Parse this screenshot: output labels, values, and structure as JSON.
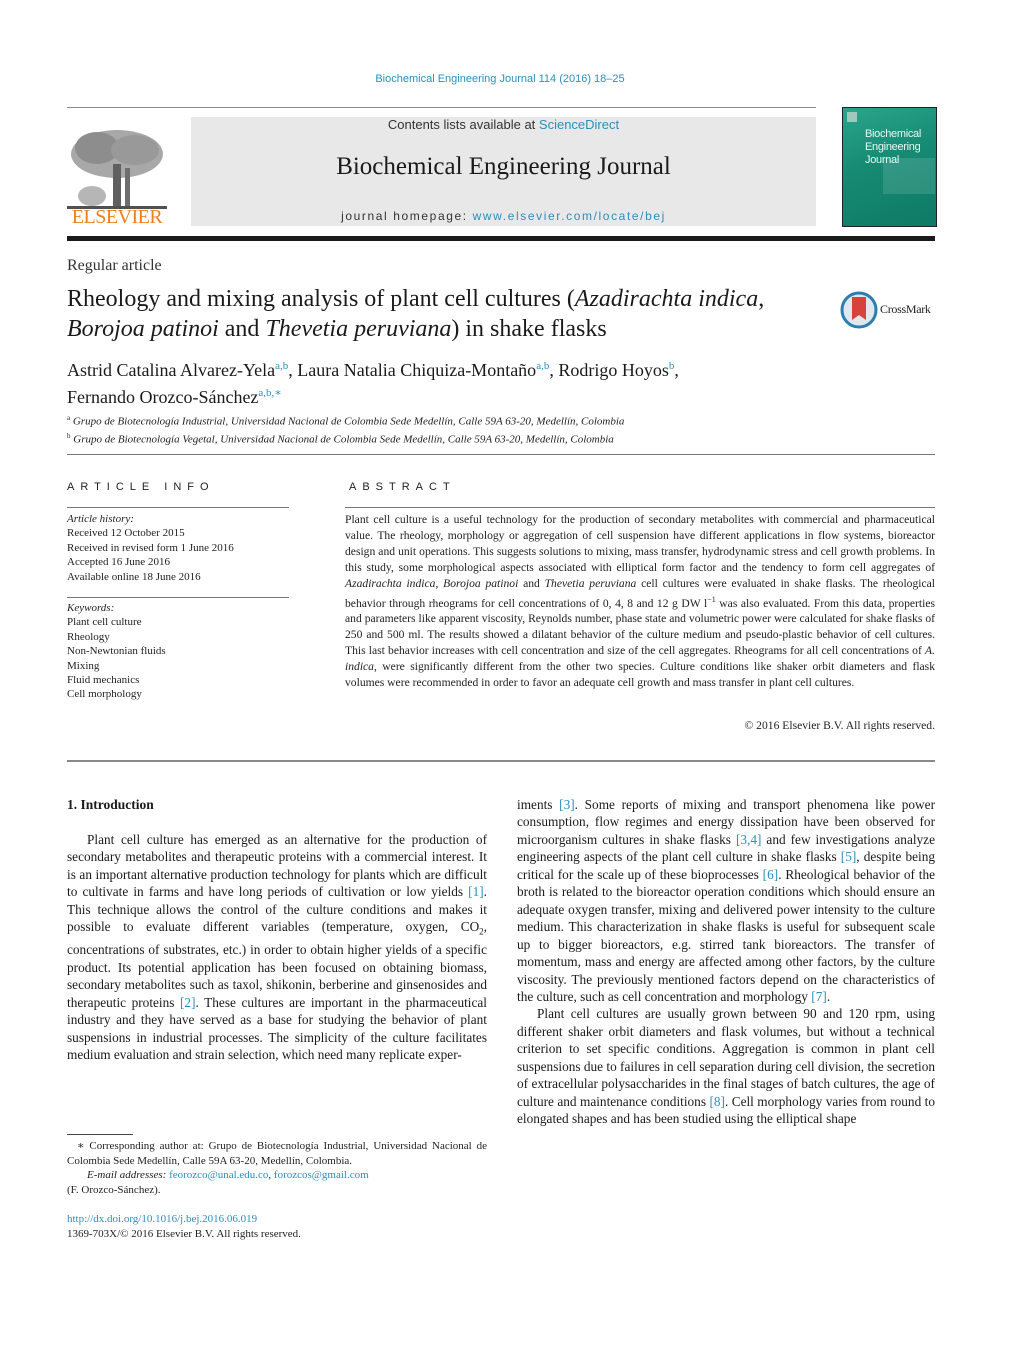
{
  "header": {
    "citation": "Biochemical Engineering Journal 114 (2016) 18–25",
    "contents_prefix": "Contents lists available at ",
    "contents_link": "ScienceDirect",
    "journal_name": "Biochemical Engineering Journal",
    "homepage_prefix": "journal homepage: ",
    "homepage_link": "www.elsevier.com/locate/bej",
    "publisher_wordmark": "ELSEVIER",
    "cover_title_lines": [
      "Biochemical",
      "Engineering",
      "Journal"
    ],
    "colors": {
      "link": "#2a8fbd",
      "elsevier_orange": "#f07f1a",
      "cover_green": "#168a73",
      "panel_gray": "#e8e8e8"
    }
  },
  "article": {
    "type": "Regular article",
    "title_parts": [
      {
        "text": "Rheology and mixing analysis of plant cell cultures (",
        "italic": false
      },
      {
        "text": "Azadirachta indica",
        "italic": true
      },
      {
        "text": ", ",
        "italic": false
      },
      {
        "text": "Borojoa patinoi",
        "italic": true
      },
      {
        "text": " and ",
        "italic": false
      },
      {
        "text": "Thevetia peruviana",
        "italic": true
      },
      {
        "text": ") in shake flasks",
        "italic": false
      }
    ],
    "crossmark_label": "CrossMark",
    "authors": [
      {
        "name": "Astrid Catalina Alvarez-Yela",
        "affil": "a,b"
      },
      {
        "name": "Laura Natalia Chiquiza-Montaño",
        "affil": "a,b"
      },
      {
        "name": "Rodrigo Hoyos",
        "affil": "b"
      },
      {
        "name": "Fernando Orozco-Sánchez",
        "affil": "a,b,∗"
      }
    ],
    "affiliations": [
      {
        "mark": "a",
        "text": "Grupo de Biotecnología Industrial, Universidad Nacional de Colombia Sede Medellín, Calle 59A 63-20, Medellín, Colombia"
      },
      {
        "mark": "b",
        "text": "Grupo de Biotecnología Vegetal, Universidad Nacional de Colombia Sede Medellín, Calle 59A 63-20, Medellín, Colombia"
      }
    ]
  },
  "article_info": {
    "heading": "ARTICLE INFO",
    "history_label": "Article history:",
    "history": [
      "Received 12 October 2015",
      "Received in revised form 1 June 2016",
      "Accepted 16 June 2016",
      "Available online 18 June 2016"
    ],
    "keywords_label": "Keywords:",
    "keywords": [
      "Plant cell culture",
      "Rheology",
      "Non-Newtonian fluids",
      "Mixing",
      "Fluid mechanics",
      "Cell morphology"
    ]
  },
  "abstract": {
    "heading": "ABSTRACT",
    "text_1": "Plant cell culture is a useful technology for the production of secondary metabolites with commercial and pharmaceutical value. The rheology, morphology or aggregation of cell suspension have different applications in flow systems, bioreactor design and unit operations. This suggests solutions to mixing, mass transfer, hydrodynamic stress and cell growth problems. In this study, some morphological aspects associated with elliptical form factor and the tendency to form cell aggregates of ",
    "species_1": "Azadirachta indica",
    "sep_1": ", ",
    "species_2": "Borojoa patinoi",
    "sep_2": " and ",
    "species_3": "Thevetia peruviana",
    "text_2": " cell cultures were evaluated in shake flasks. The rheological behavior through rheograms for cell concentrations of 0, 4, 8 and 12 g DW l",
    "exponent": "−1",
    "text_3": " was also evaluated. From this data, properties and parameters like apparent viscosity, Reynolds number, phase state and volumetric power were calculated for shake flasks of 250 and 500 ml. The results showed a dilatant behavior of the culture medium and pseudo-plastic behavior of cell cultures. This last behavior increases with cell concentration and size of the cell aggregates. Rheograms for all cell concentrations of ",
    "species_4": "A. indica",
    "text_4": ", were significantly different from the other two species. Culture conditions like shaker orbit diameters and flask volumes were recommended in order to favor an adequate cell growth and mass transfer in plant cell cultures.",
    "copyright": "© 2016 Elsevier B.V. All rights reserved."
  },
  "body": {
    "section_heading": "1.  Introduction",
    "left": {
      "p1_a": "Plant cell culture has emerged as an alternative for the production of secondary metabolites and therapeutic proteins with a commercial interest. It is an important alternative production technology for plants which are difficult to cultivate in farms and have long periods of cultivation or low yields ",
      "ref_1": "[1]",
      "p1_b": ". This technique allows the control of the culture conditions and makes it possible to evaluate different variables (temperature, oxygen, CO",
      "co2_sub": "2",
      "p1_c": ", concentrations of substrates, etc.) in order to obtain higher yields of a specific product. Its potential application has been focused on obtaining biomass, secondary metabolites such as taxol, shikonin, berberine and ginsenosides and therapeutic proteins ",
      "ref_2": "[2]",
      "p1_d": ". These cultures are important in the pharmaceutical industry and they have served as a base for studying the behavior of plant suspensions in industrial processes. The simplicity of the culture facilitates medium evaluation and strain selection, which need many replicate exper-"
    },
    "right": {
      "p1_a": "iments ",
      "ref_3": "[3]",
      "p1_b": ". Some reports of mixing and transport phenomena like power consumption, flow regimes and energy dissipation have been observed for microorganism cultures in shake flasks ",
      "ref_34": "[3,4]",
      "p1_c": " and few investigations analyze engineering aspects of the plant cell culture in shake flasks ",
      "ref_5": "[5]",
      "p1_d": ", despite being critical for the scale up of these bioprocesses ",
      "ref_6": "[6]",
      "p1_e": ". Rheological behavior of the broth is related to the bioreactor operation conditions which should ensure an adequate oxygen transfer, mixing and delivered power intensity to the culture medium. This characterization in shake flasks is useful for subsequent scale up to bigger bioreactors, e.g. stirred tank bioreactors. The transfer of momentum, mass and energy are affected among other factors, by the culture viscosity. The previously mentioned factors depend on the characteristics of the culture, such as cell concentration and morphology ",
      "ref_7": "[7]",
      "p1_f": ".",
      "p2_a": "Plant cell cultures are usually grown between 90 and 120 rpm, using different shaker orbit diameters and flask volumes, but without a technical criterion to set specific conditions. Aggregation is common in plant cell suspensions due to failures in cell separation during cell division, the secretion of extracellular polysaccharides in the final stages of batch cultures, the age of culture and maintenance conditions ",
      "ref_8": "[8]",
      "p2_b": ". Cell morphology varies from round to elongated shapes and has been studied using the elliptical shape"
    }
  },
  "footnote": {
    "corresponding": "∗  Corresponding author at: Grupo de Biotecnología Industrial, Universidad Nacional de Colombia Sede Medellín, Calle 59A 63-20, Medellín, Colombia.",
    "email_label": "E-mail addresses:",
    "email_1": "feorozco@unal.edu.co",
    "email_sep": ", ",
    "email_2": "forozcos@gmail.com",
    "email_owner": "(F. Orozco-Sánchez).",
    "doi": "http://dx.doi.org/10.1016/j.bej.2016.06.019",
    "issn_line": "1369-703X/© 2016 Elsevier B.V. All rights reserved."
  }
}
